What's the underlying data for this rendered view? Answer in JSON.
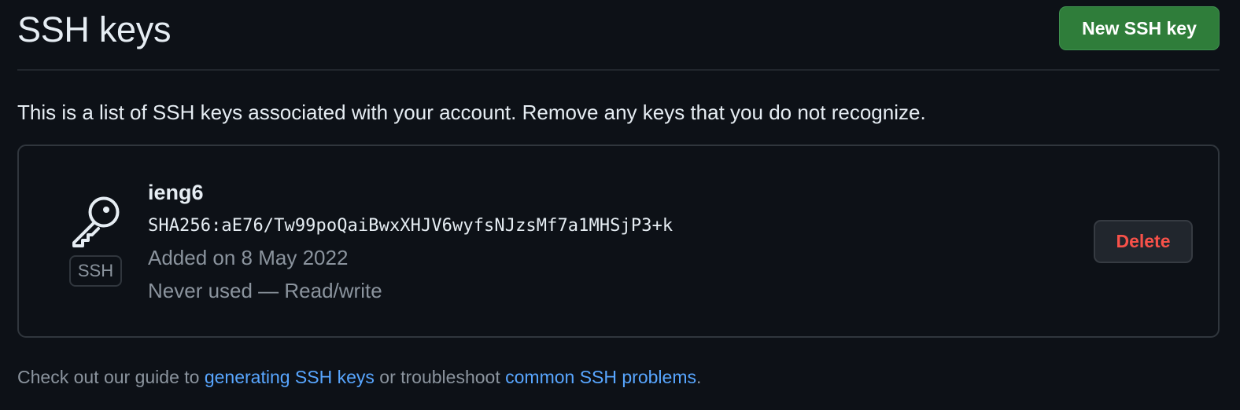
{
  "header": {
    "title": "SSH keys",
    "new_key_button": "New SSH key"
  },
  "intro_text": "This is a list of SSH keys associated with your account. Remove any keys that you do not recognize.",
  "keys": [
    {
      "icon": "key-icon",
      "badge": "SSH",
      "title": "ieng6",
      "fingerprint": "SHA256:aE76/Tw99poQaiBwxXHJV6wyfsNJzsMf7a1MHSjP3+k",
      "added": "Added on 8 May 2022",
      "usage": "Never used — Read/write",
      "delete_label": "Delete"
    }
  ],
  "footer": {
    "prefix": "Check out our guide to ",
    "link1": "generating SSH keys",
    "middle": " or troubleshoot ",
    "link2": "common SSH problems",
    "suffix": "."
  },
  "colors": {
    "background": "#0d1117",
    "primary_button": "#2f7d3a",
    "danger_text": "#f85149",
    "link": "#58a6ff",
    "muted_text": "#8b949e"
  }
}
